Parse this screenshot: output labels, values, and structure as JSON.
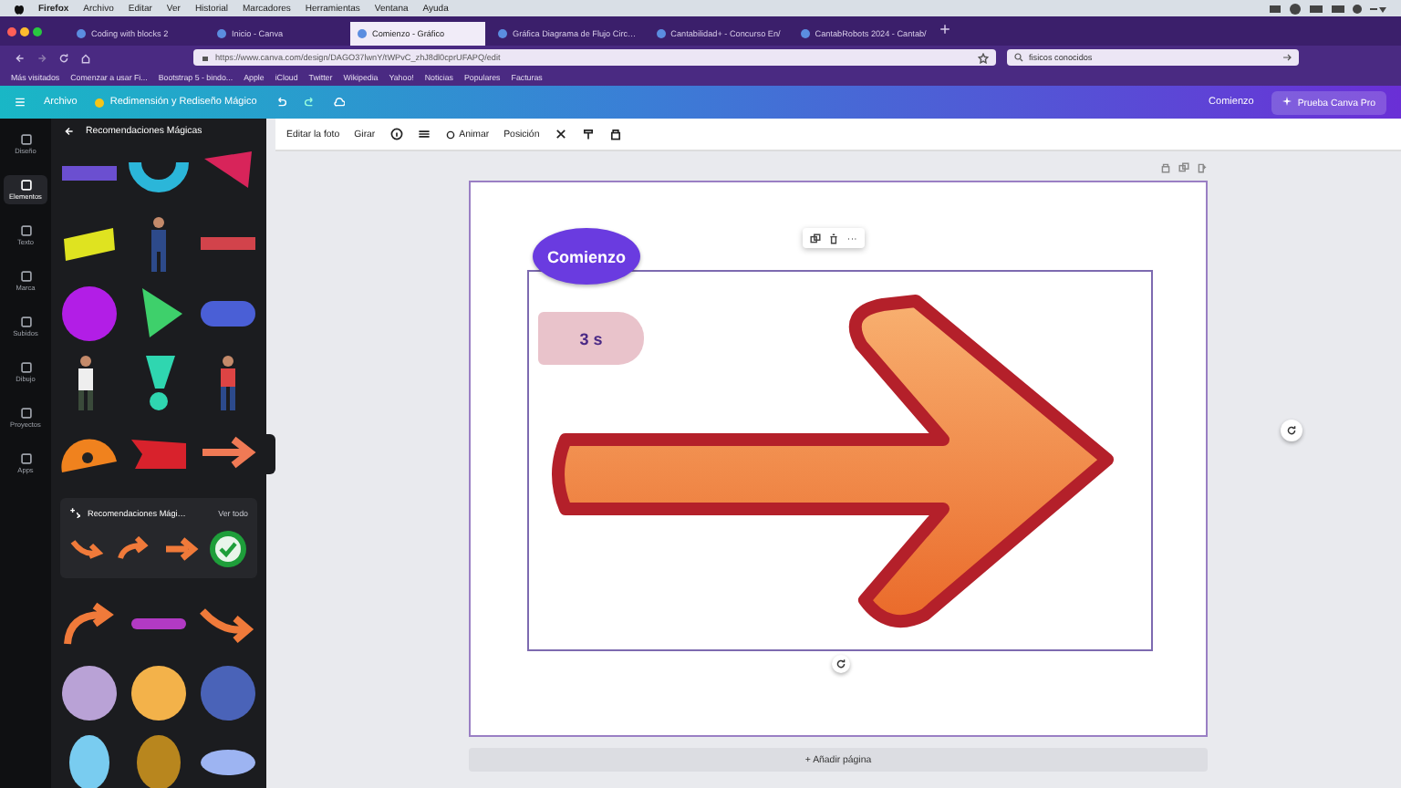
{
  "menubar": {
    "items": [
      "Firefox",
      "Archivo",
      "Editar",
      "Ver",
      "Historial",
      "Marcadores",
      "Herramientas",
      "Ventana",
      "Ayuda"
    ]
  },
  "browser": {
    "tabs": [
      {
        "title": "Coding with blocks 2",
        "selected": false
      },
      {
        "title": "Inicio - Canva",
        "selected": false
      },
      {
        "title": "Comienzo - Gráfico",
        "selected": true
      },
      {
        "title": "Gráfica Diagrama de Flujo Circ…",
        "selected": false
      },
      {
        "title": "Cantabilidad+ - Concurso En/",
        "selected": false
      },
      {
        "title": "CantabRobots 2024 - Cantab/",
        "selected": false
      }
    ],
    "url": "https://www.canva.com/design/DAGO37lwnY/tWPvC_zhJ8dl0cprUFAPQ/edit",
    "search": "fisicos conocidos",
    "bookmarks": [
      "Más visitados",
      "Comenzar a usar Fi...",
      "Bootstrap 5 - bindo...",
      "Apple",
      "iCloud",
      "Twitter",
      "Wikipedia",
      "Yahoo!",
      "Noticias",
      "Populares",
      "Facturas"
    ]
  },
  "header": {
    "file_menu": "Archivo",
    "magic": "Redimensión y Rediseño Mágico",
    "doc_title": "Comienzo",
    "pro_button": "Prueba Canva Pro"
  },
  "rail": [
    {
      "label": "Diseño",
      "selected": false
    },
    {
      "label": "Elementos",
      "selected": true
    },
    {
      "label": "Texto",
      "selected": false
    },
    {
      "label": "Marca",
      "selected": false
    },
    {
      "label": "Subidos",
      "selected": false
    },
    {
      "label": "Dibujo",
      "selected": false
    },
    {
      "label": "Proyectos",
      "selected": false
    },
    {
      "label": "Apps",
      "selected": false
    }
  ],
  "panel": {
    "title": "Recomendaciones Mágicas",
    "recommendations": {
      "title": "Recomendaciones Mági…",
      "link": "Ver todo"
    }
  },
  "toolbar": {
    "edit_photo": "Editar la foto",
    "rotate": "Girar",
    "animate": "Animar",
    "position": "Posición"
  },
  "canvas": {
    "start_label": "Comienzo",
    "duration_tag": "3 s",
    "add_page": "+ Añadir página"
  }
}
